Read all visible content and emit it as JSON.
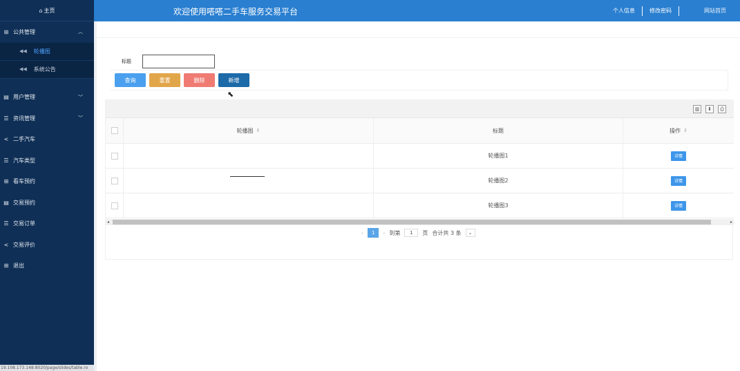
{
  "sidebar": {
    "home": "主页",
    "items": [
      {
        "label": "公共管理",
        "icon": "grid-icon",
        "expanded": true,
        "children": [
          {
            "label": "轮播图",
            "active": true
          },
          {
            "label": "系统公告",
            "active": false
          }
        ]
      },
      {
        "label": "用户管理",
        "icon": "doc-icon",
        "arrow": "chevron-down"
      },
      {
        "label": "资讯管理",
        "icon": "list-icon",
        "arrow": "chevron-down"
      },
      {
        "label": "二手汽车",
        "icon": "share-icon"
      },
      {
        "label": "汽车类型",
        "icon": "list-icon"
      },
      {
        "label": "看车预约",
        "icon": "grid-icon"
      },
      {
        "label": "交易预约",
        "icon": "doc-icon"
      },
      {
        "label": "交易订单",
        "icon": "list-icon"
      },
      {
        "label": "交易评价",
        "icon": "share-icon"
      },
      {
        "label": "退出",
        "icon": "grid-icon"
      }
    ],
    "status_url": "19.108.173.148:8020/page/slides/table.ro"
  },
  "topbar": {
    "title": "欢迎使用嗒嗒二手车服务交易平台",
    "links": [
      "个人信息",
      "修改密码",
      "网站首页"
    ]
  },
  "search": {
    "label": "标题",
    "value": ""
  },
  "buttons": {
    "query": "查询",
    "reset": "重置",
    "delete": "删除",
    "add": "新增"
  },
  "table": {
    "headers": {
      "image": "轮播图",
      "title": "标题",
      "op": "操作"
    },
    "rows": [
      {
        "title": "轮播图1",
        "detail": "详情"
      },
      {
        "title": "轮播图2",
        "detail": "详情"
      },
      {
        "title": "轮播图3",
        "detail": "详情"
      }
    ]
  },
  "pager": {
    "current": "1",
    "goto_label": "到第",
    "goto_value": "1",
    "page_unit": "页",
    "total": "合计共 3 条"
  }
}
